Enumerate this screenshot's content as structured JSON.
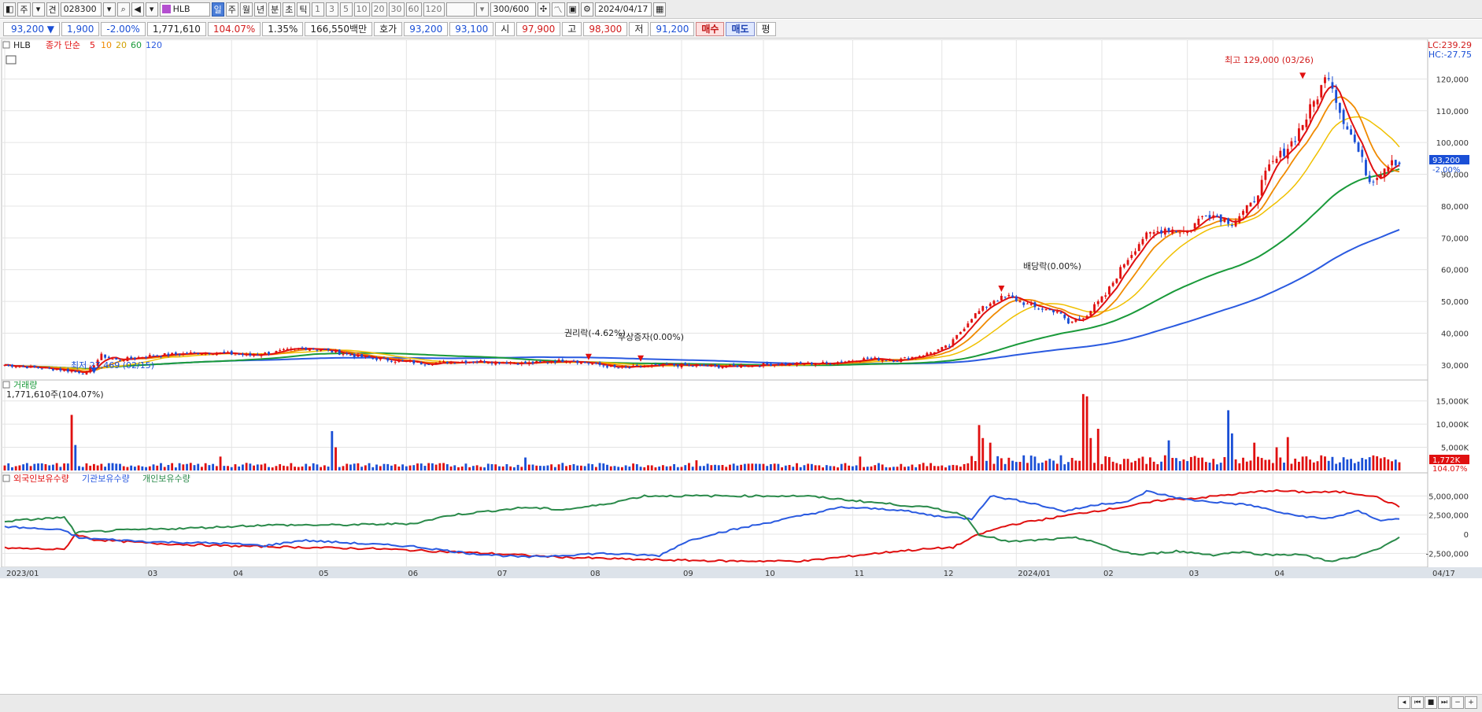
{
  "toolbar": {
    "items": [
      "주",
      "견"
    ],
    "code": "028300",
    "stock_name": "HLB",
    "periods": [
      "일",
      "주",
      "월",
      "년",
      "분",
      "초",
      "틱"
    ],
    "minutes": [
      "1",
      "3",
      "5",
      "10",
      "20",
      "30",
      "60",
      "120"
    ],
    "count": "300/600",
    "date": "2024/04/17"
  },
  "quote": {
    "price": "93,200 ▼",
    "change": "1,900",
    "change_pct": "-2.00%",
    "volume": "1,771,610",
    "vol_ratio": "104.07%",
    "turnover": "1.35%",
    "amount": "166,550백만",
    "ask_label": "호가",
    "ask1": "93,200",
    "ask2": "93,100",
    "open_label": "시",
    "open": "97,900",
    "high_label": "고",
    "high": "98,300",
    "low_label": "저",
    "low": "91,200",
    "buy_label": "매수",
    "sell_label": "매도",
    "eval_label": "평"
  },
  "legend": {
    "name": "HLB",
    "price_label": "종가 단순",
    "ma_periods": [
      "5",
      "10",
      "20",
      "60",
      "120"
    ],
    "lc": "LC:239.29",
    "hc": "HC:-27.75"
  },
  "annotations": {
    "high": "최고 129,000 (03/26)",
    "low": "최저 27,469 (02/15)",
    "rights": "권리락(-4.62%)",
    "bonus": "무상증자(0.00%)",
    "dividend": "배당락(0.00%)"
  },
  "current": {
    "price": "93,200",
    "pct": "-2.00%",
    "vol": "1,772K",
    "vol_pct": "104.07%"
  },
  "volume_panel": {
    "title": "거래량",
    "value": "1,771,610주(104.07%)"
  },
  "holdings_panel": {
    "series": [
      "외국인보유수량",
      "기관보유수량",
      "개인보유수량"
    ]
  },
  "x_labels": [
    "2023/01",
    "03",
    "04",
    "05",
    "06",
    "07",
    "08",
    "09",
    "10",
    "11",
    "12",
    "2024/01",
    "02",
    "03",
    "04",
    "04/17"
  ],
  "colors": {
    "up": "#e01010",
    "down": "#1a4fd6",
    "ma5": "#e01010",
    "ma10": "#f08a00",
    "ma20": "#f0c000",
    "ma60": "#1a9a3a",
    "ma120": "#2a5ae0",
    "foreign": "#e01010",
    "inst": "#2a5ae0",
    "indiv": "#2a8a4a"
  },
  "chart_data": [
    {
      "type": "candlestick",
      "title": "HLB",
      "ylim": [
        26000,
        131000
      ],
      "y_ticks": [
        30000,
        40000,
        50000,
        60000,
        70000,
        80000,
        90000,
        100000,
        110000,
        120000
      ],
      "y_tick_labels": [
        "30,000",
        "40,000",
        "50,000",
        "60,000",
        "70,000",
        "80,000",
        "90,000",
        "100,000",
        "110,000",
        "120,000"
      ],
      "x_labels": [
        "2023/01",
        "03",
        "04",
        "05",
        "06",
        "07",
        "08",
        "09",
        "10",
        "11",
        "12",
        "2024/01",
        "02",
        "03",
        "04"
      ],
      "anchors": [
        [
          0,
          30000
        ],
        [
          15,
          28500
        ],
        [
          22,
          27500
        ],
        [
          26,
          33000
        ],
        [
          30,
          31500
        ],
        [
          40,
          33000
        ],
        [
          55,
          34000
        ],
        [
          66,
          33000
        ],
        [
          82,
          35500
        ],
        [
          96,
          32500
        ],
        [
          112,
          30500
        ],
        [
          126,
          31200
        ],
        [
          140,
          30500
        ],
        [
          152,
          31500
        ],
        [
          165,
          29000
        ],
        [
          178,
          30000
        ],
        [
          193,
          29500
        ],
        [
          206,
          30200
        ],
        [
          221,
          30500
        ],
        [
          232,
          32000
        ],
        [
          240,
          31500
        ],
        [
          248,
          33500
        ],
        [
          254,
          36000
        ],
        [
          260,
          45000
        ],
        [
          266,
          50500
        ],
        [
          270,
          51500
        ],
        [
          277,
          48000
        ],
        [
          283,
          47000
        ],
        [
          286,
          43000
        ],
        [
          291,
          46000
        ],
        [
          296,
          52000
        ],
        [
          301,
          62000
        ],
        [
          306,
          70000
        ],
        [
          312,
          73000
        ],
        [
          318,
          72000
        ],
        [
          323,
          78000
        ],
        [
          330,
          75000
        ],
        [
          335,
          80000
        ],
        [
          340,
          92000
        ],
        [
          346,
          100000
        ],
        [
          350,
          108000
        ],
        [
          353,
          115000
        ],
        [
          356,
          122000
        ],
        [
          359,
          110000
        ],
        [
          363,
          100000
        ],
        [
          367,
          88000
        ],
        [
          370,
          91000
        ],
        [
          373,
          95000
        ],
        [
          375,
          93200
        ]
      ],
      "last_close": 93200,
      "ma5_last": 93000,
      "ma20_last": 101000,
      "ma60_last": 84000,
      "ma120_last": 61000
    },
    {
      "type": "bar",
      "title": "거래량",
      "ylim": [
        0,
        18000
      ],
      "y_ticks": [
        5000,
        10000,
        15000
      ],
      "y_tick_labels": [
        "5,000K",
        "10,000K",
        "15,000K"
      ],
      "spikes": [
        [
          18,
          12000
        ],
        [
          19,
          5500
        ],
        [
          58,
          3000
        ],
        [
          88,
          8500
        ],
        [
          89,
          5000
        ],
        [
          140,
          2800
        ],
        [
          186,
          2200
        ],
        [
          230,
          3000
        ],
        [
          262,
          9800
        ],
        [
          263,
          7000
        ],
        [
          265,
          6000
        ],
        [
          290,
          16500
        ],
        [
          291,
          16000
        ],
        [
          292,
          7000
        ],
        [
          294,
          9000
        ],
        [
          313,
          6500
        ],
        [
          329,
          13000
        ],
        [
          330,
          8000
        ],
        [
          336,
          6000
        ],
        [
          342,
          5000
        ],
        [
          345,
          7200
        ],
        [
          349,
          3000
        ],
        [
          353,
          2000
        ],
        [
          362,
          2500
        ],
        [
          375,
          1772
        ]
      ]
    },
    {
      "type": "line",
      "title": "보유수량",
      "ylim": [
        -4000000,
        7500000
      ],
      "y_ticks": [
        -2500000,
        0,
        2500000,
        5000000
      ],
      "y_tick_labels": [
        "-2,500,000",
        "0",
        "2,500,000",
        "5,000,000"
      ],
      "series": [
        {
          "name": "외국인보유수량",
          "anchors": [
            [
              0,
              -1800000
            ],
            [
              16,
              -2000000
            ],
            [
              19,
              0
            ],
            [
              24,
              -700000
            ],
            [
              40,
              -1200000
            ],
            [
              58,
              -1500000
            ],
            [
              80,
              -1700000
            ],
            [
              100,
              -1900000
            ],
            [
              130,
              -2500000
            ],
            [
              150,
              -3000000
            ],
            [
              170,
              -3300000
            ],
            [
              195,
              -3500000
            ],
            [
              215,
              -3500000
            ],
            [
              240,
              -2200000
            ],
            [
              255,
              -1700000
            ],
            [
              262,
              0
            ],
            [
              270,
              1200000
            ],
            [
              280,
              2000000
            ],
            [
              290,
              2800000
            ],
            [
              300,
              3500000
            ],
            [
              312,
              4500000
            ],
            [
              320,
              4700000
            ],
            [
              330,
              5200000
            ],
            [
              340,
              5700000
            ],
            [
              350,
              5500000
            ],
            [
              360,
              5500000
            ],
            [
              368,
              5000000
            ],
            [
              375,
              3600000
            ]
          ]
        },
        {
          "name": "기관보유수량",
          "anchors": [
            [
              0,
              1000000
            ],
            [
              16,
              500000
            ],
            [
              20,
              -500000
            ],
            [
              40,
              -1000000
            ],
            [
              60,
              -1200000
            ],
            [
              70,
              -1500000
            ],
            [
              80,
              -800000
            ],
            [
              95,
              -1200000
            ],
            [
              110,
              -1600000
            ],
            [
              125,
              -2500000
            ],
            [
              140,
              -3000000
            ],
            [
              160,
              -2500000
            ],
            [
              176,
              -2800000
            ],
            [
              183,
              -1000000
            ],
            [
              190,
              0
            ],
            [
              210,
              2000000
            ],
            [
              225,
              3500000
            ],
            [
              240,
              3200000
            ],
            [
              250,
              2400000
            ],
            [
              260,
              2000000
            ],
            [
              265,
              5000000
            ],
            [
              275,
              4200000
            ],
            [
              285,
              3000000
            ],
            [
              295,
              4000000
            ],
            [
              302,
              4200000
            ],
            [
              307,
              5600000
            ],
            [
              318,
              4500000
            ],
            [
              335,
              3800000
            ],
            [
              345,
              2600000
            ],
            [
              355,
              2000000
            ],
            [
              364,
              3000000
            ],
            [
              370,
              1800000
            ],
            [
              375,
              2000000
            ]
          ]
        },
        {
          "name": "개인보유수량",
          "anchors": [
            [
              0,
              1700000
            ],
            [
              16,
              2200000
            ],
            [
              19,
              200000
            ],
            [
              30,
              500000
            ],
            [
              50,
              800000
            ],
            [
              70,
              1200000
            ],
            [
              90,
              1200000
            ],
            [
              110,
              1400000
            ],
            [
              120,
              2500000
            ],
            [
              140,
              3500000
            ],
            [
              150,
              3200000
            ],
            [
              160,
              3800000
            ],
            [
              172,
              5000000
            ],
            [
              195,
              5000000
            ],
            [
              215,
              5000000
            ],
            [
              226,
              4500000
            ],
            [
              250,
              3400000
            ],
            [
              258,
              2500000
            ],
            [
              262,
              0
            ],
            [
              270,
              -1000000
            ],
            [
              280,
              -700000
            ],
            [
              288,
              -500000
            ],
            [
              292,
              -800000
            ],
            [
              298,
              -2000000
            ],
            [
              305,
              -2700000
            ],
            [
              315,
              -2200000
            ],
            [
              325,
              -2700000
            ],
            [
              332,
              -2300000
            ],
            [
              340,
              -2700000
            ],
            [
              348,
              -2600000
            ],
            [
              356,
              -3500000
            ],
            [
              363,
              -3000000
            ],
            [
              370,
              -1800000
            ],
            [
              375,
              -300000
            ]
          ]
        }
      ]
    }
  ]
}
